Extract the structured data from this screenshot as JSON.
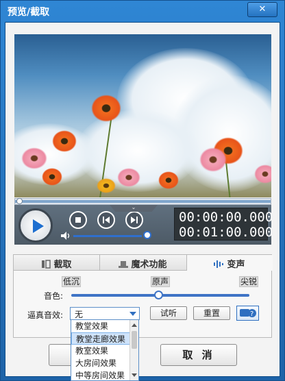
{
  "window": {
    "title": "预览/截取",
    "close_label": "✕"
  },
  "player": {
    "current_time": "00:00:00.000",
    "total_time": "00:01:00.000",
    "volume_level": 0.95,
    "seek_position": 0.0
  },
  "tabs": [
    {
      "label": "截取",
      "icon": "film-icon"
    },
    {
      "label": "魔术功能",
      "icon": "magic-hat-icon"
    },
    {
      "label": "变声",
      "icon": "sound-wave-icon"
    }
  ],
  "voice": {
    "tone_label": "音色:",
    "low_label": "低沉",
    "mid_label": "原声",
    "high_label": "尖锐",
    "tone_level": 0.5,
    "effect_label": "逼真音效:",
    "effect_value": "无",
    "preview_button": "试听",
    "reset_button": "重置",
    "help_icon": "help-icon"
  },
  "dropdown": {
    "options": [
      "教堂效果",
      "教堂走廊效果",
      "教室效果",
      "大房间效果",
      "中等房间效果"
    ],
    "highlighted_index": 1
  },
  "footer": {
    "cancel_button": "取 消"
  },
  "colors": {
    "accent": "#1e6fd0",
    "title_bar": "#2f86d4",
    "panel": "#4d5a66"
  }
}
